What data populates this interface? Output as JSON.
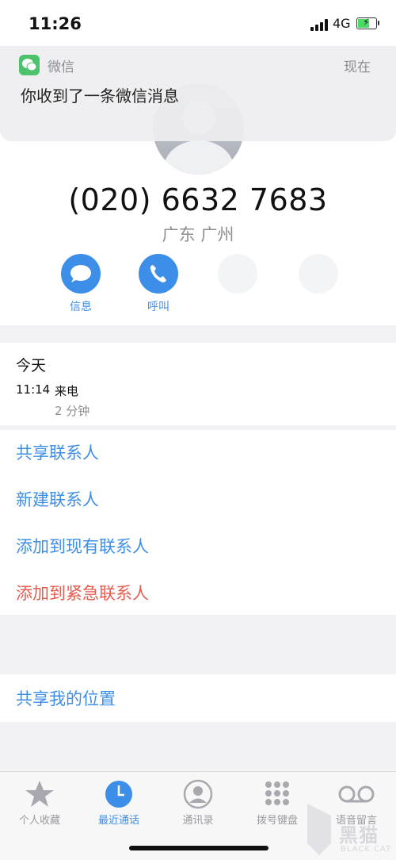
{
  "status": {
    "time": "11:26",
    "network": "4G"
  },
  "notification": {
    "app": "微信",
    "when": "现在",
    "message": "你收到了一条微信消息"
  },
  "contact": {
    "phone": "(020) 6632 7683",
    "location": "广东 广州"
  },
  "actions": [
    {
      "label": "信息",
      "icon": "message-icon"
    },
    {
      "label": "呼叫",
      "icon": "phone-icon"
    }
  ],
  "recents": {
    "section": "今天",
    "entries": [
      {
        "time": "11:14",
        "type": "来电",
        "duration": "2 分钟"
      }
    ]
  },
  "options": {
    "share_contact": "共享联系人",
    "new_contact": "新建联系人",
    "add_existing": "添加到现有联系人",
    "add_emergency": "添加到紧急联系人",
    "share_location": "共享我的位置"
  },
  "tabbar": [
    {
      "label": "个人收藏",
      "icon": "star-icon",
      "active": false
    },
    {
      "label": "最近通话",
      "icon": "clock-icon",
      "active": true
    },
    {
      "label": "通讯录",
      "icon": "contacts-icon",
      "active": false
    },
    {
      "label": "拨号键盘",
      "icon": "keypad-icon",
      "active": false
    },
    {
      "label": "语音留言",
      "icon": "voicemail-icon",
      "active": false
    }
  ],
  "watermark": {
    "brand": "黑猫",
    "brand_en": "BLACK CAT"
  },
  "colors": {
    "accent": "#3d8ee8",
    "danger": "#e55b4f",
    "wechat": "#4cc26d"
  }
}
